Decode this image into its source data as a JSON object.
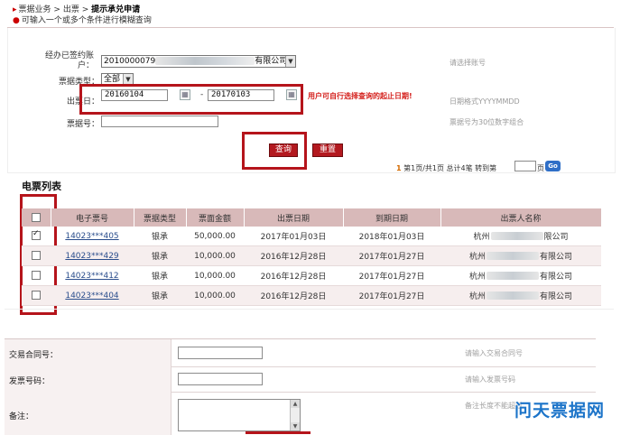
{
  "breadcrumb": {
    "marker": "▸",
    "items": [
      "票据业务",
      "出票"
    ],
    "current": "提示承兑申请",
    "sep": ">"
  },
  "hint": "可输入一个或多个条件进行模糊查询",
  "form": {
    "account_label": "经办已签约账户：",
    "account_value_prefix": "2010000079",
    "account_value_suffix": "有限公司]",
    "account_help": "请选择账号",
    "bill_type_label": "票据类型：",
    "bill_type_value": "全部",
    "issue_date_label": "出票日：",
    "date_from": "20160104",
    "date_to": "20170103",
    "date_dash": "-",
    "date_help": "日期格式YYYYMMDD",
    "bill_no_label": "票据号：",
    "bill_no_value": "",
    "bill_no_help": "票据号为30位数字组合",
    "annotation": "用户可自行选择查询的起止日期!"
  },
  "buttons": {
    "query": "查询",
    "reset": "重置"
  },
  "pager": {
    "current": "1",
    "text": "第1页/共1页  总计4笔  转到第",
    "page_unit": "页",
    "go": "Go"
  },
  "section_title": "电票列表",
  "table": {
    "headers": [
      "",
      "电子票号",
      "票据类型",
      "票面金额",
      "出票日期",
      "到期日期",
      "出票人名称"
    ],
    "rows": [
      {
        "checked": true,
        "no": "14023***405",
        "type": "银承",
        "amount": "50,000.00",
        "issue": "2017年01月03日",
        "due": "2018年01月03日",
        "payee_start": "杭州",
        "payee_end": "限公司"
      },
      {
        "checked": false,
        "no": "14023***429",
        "type": "银承",
        "amount": "10,000.00",
        "issue": "2016年12月28日",
        "due": "2017年01月27日",
        "payee_start": "杭州",
        "payee_end": "有限公司"
      },
      {
        "checked": false,
        "no": "14023***412",
        "type": "银承",
        "amount": "10,000.00",
        "issue": "2016年12月28日",
        "due": "2017年01月27日",
        "payee_start": "杭州",
        "payee_end": "有限公司"
      },
      {
        "checked": false,
        "no": "14023***404",
        "type": "银承",
        "amount": "10,000.00",
        "issue": "2016年12月28日",
        "due": "2017年01月27日",
        "payee_start": "杭州",
        "payee_end": "有限公司"
      }
    ]
  },
  "form2": {
    "contract_label": "交易合同号：",
    "contract_help": "请输入交易合同号",
    "invoice_label": "发票号码：",
    "invoice_help": "请输入发票号码",
    "remark_label": "备注：",
    "remark_help": "备注长度不能超过"
  },
  "watermark": "问天票据网",
  "colors": {
    "accent": "#b3191f",
    "header_bg": "#d8b9b9",
    "annotation": "#d4201c",
    "link": "#2a4d8c",
    "watermark": "#1c74c9"
  }
}
